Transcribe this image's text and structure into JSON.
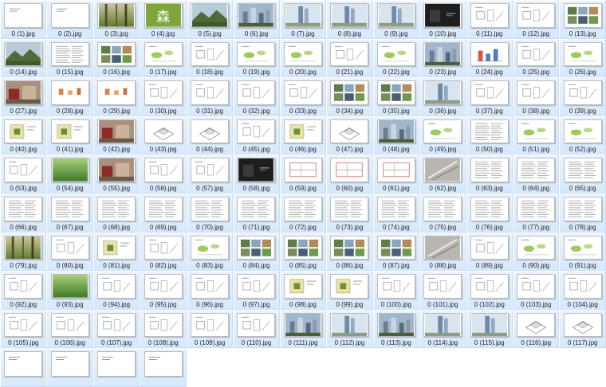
{
  "folder": {
    "colors": {
      "tile_top": "#eaf3fd",
      "tile_bottom": "#d6e8fb",
      "text": "#1f1f1f"
    },
    "thumb_icon": "image-thumbnail-icon",
    "files": [
      {
        "name": "0 (1).jpg",
        "kind": "doc-sparse"
      },
      {
        "name": "0 (2).jpg",
        "kind": "doc-sparse"
      },
      {
        "name": "0 (3).jpg",
        "kind": "photo-forest"
      },
      {
        "name": "0 (4).jpg",
        "kind": "green-glyph",
        "glyph": "森"
      },
      {
        "name": "0 (5).jpg",
        "kind": "photo-mountain"
      },
      {
        "name": "0 (6).jpg",
        "kind": "photo-city"
      },
      {
        "name": "0 (7).jpg",
        "kind": "photo-towers"
      },
      {
        "name": "0 (8).jpg",
        "kind": "photo-towers"
      },
      {
        "name": "0 (9).jpg",
        "kind": "photo-towers"
      },
      {
        "name": "0 (10).jpg",
        "kind": "dark-cover"
      },
      {
        "name": "0 (11).jpg",
        "kind": "diagram"
      },
      {
        "name": "0 (12).jpg",
        "kind": "diagram"
      },
      {
        "name": "0 (13).jpg",
        "kind": "photo-collage"
      },
      {
        "name": "0 (14).jpg",
        "kind": "photo-mountain"
      },
      {
        "name": "0 (15).jpg",
        "kind": "doc-text"
      },
      {
        "name": "0 (16).jpg",
        "kind": "photo-collage"
      },
      {
        "name": "0 (17).jpg",
        "kind": "diagram-green"
      },
      {
        "name": "0 (18).jpg",
        "kind": "diagram"
      },
      {
        "name": "0 (19).jpg",
        "kind": "diagram-green"
      },
      {
        "name": "0 (20).jpg",
        "kind": "diagram-green"
      },
      {
        "name": "0 (21).jpg",
        "kind": "diagram"
      },
      {
        "name": "0 (22).jpg",
        "kind": "diagram-green"
      },
      {
        "name": "0 (23).jpg",
        "kind": "photo-city"
      },
      {
        "name": "0 (24).jpg",
        "kind": "chart-bars"
      },
      {
        "name": "0 (25).jpg",
        "kind": "diagram"
      },
      {
        "name": "0 (26).jpg",
        "kind": "diagram-green"
      },
      {
        "name": "0 (27).jpg",
        "kind": "photo-red"
      },
      {
        "name": "0 (28).jpg",
        "kind": "diagram-orange"
      },
      {
        "name": "0 (29).jpg",
        "kind": "diagram-orange"
      },
      {
        "name": "0 (30).jpg",
        "kind": "diagram"
      },
      {
        "name": "0 (31).jpg",
        "kind": "diagram"
      },
      {
        "name": "0 (32).jpg",
        "kind": "diagram"
      },
      {
        "name": "0 (33).jpg",
        "kind": "diagram"
      },
      {
        "name": "0 (34).jpg",
        "kind": "photo-collage"
      },
      {
        "name": "0 (35).jpg",
        "kind": "photo-collage"
      },
      {
        "name": "0 (36).jpg",
        "kind": "photo-towers"
      },
      {
        "name": "0 (37).jpg",
        "kind": "diagram"
      },
      {
        "name": "0 (38).jpg",
        "kind": "diagram"
      },
      {
        "name": "0 (39).jpg",
        "kind": "diagram"
      },
      {
        "name": "0 (40).jpg",
        "kind": "plan-yellow"
      },
      {
        "name": "0 (41).jpg",
        "kind": "plan-yellow"
      },
      {
        "name": "0 (42).jpg",
        "kind": "photo-red"
      },
      {
        "name": "0 (43).jpg",
        "kind": "iso-drawing"
      },
      {
        "name": "0 (44).jpg",
        "kind": "iso-drawing"
      },
      {
        "name": "0 (45).jpg",
        "kind": "diagram"
      },
      {
        "name": "0 (46).jpg",
        "kind": "plan-yellow"
      },
      {
        "name": "0 (47).jpg",
        "kind": "iso-drawing"
      },
      {
        "name": "0 (48).jpg",
        "kind": "photo-city"
      },
      {
        "name": "0 (49).jpg",
        "kind": "diagram-green"
      },
      {
        "name": "0 (50).jpg",
        "kind": "doc-text"
      },
      {
        "name": "0 (51).jpg",
        "kind": "diagram-green"
      },
      {
        "name": "0 (52).jpg",
        "kind": "diagram-green"
      },
      {
        "name": "0 (53).jpg",
        "kind": "diagram"
      },
      {
        "name": "0 (54).jpg",
        "kind": "photo-green"
      },
      {
        "name": "0 (55).jpg",
        "kind": "photo-red"
      },
      {
        "name": "0 (56).jpg",
        "kind": "diagram"
      },
      {
        "name": "0 (57).jpg",
        "kind": "diagram"
      },
      {
        "name": "0 (58).jpg",
        "kind": "dark-cover"
      },
      {
        "name": "0 (59).jpg",
        "kind": "plan-red"
      },
      {
        "name": "0 (60).jpg",
        "kind": "plan-red"
      },
      {
        "name": "0 (61).jpg",
        "kind": "plan-red"
      },
      {
        "name": "0 (62).jpg",
        "kind": "photo-gray"
      },
      {
        "name": "0 (63).jpg",
        "kind": "doc-text"
      },
      {
        "name": "0 (64).jpg",
        "kind": "doc-text"
      },
      {
        "name": "0 (65).jpg",
        "kind": "doc-text"
      },
      {
        "name": "0 (66).jpg",
        "kind": "doc-text"
      },
      {
        "name": "0 (67).jpg",
        "kind": "doc-text"
      },
      {
        "name": "0 (68).jpg",
        "kind": "doc-text"
      },
      {
        "name": "0 (69).jpg",
        "kind": "doc-text"
      },
      {
        "name": "0 (70).jpg",
        "kind": "doc-text"
      },
      {
        "name": "0 (71).jpg",
        "kind": "doc-text"
      },
      {
        "name": "0 (72).jpg",
        "kind": "doc-text"
      },
      {
        "name": "0 (73).jpg",
        "kind": "doc-text"
      },
      {
        "name": "0 (74).jpg",
        "kind": "doc-text"
      },
      {
        "name": "0 (75).jpg",
        "kind": "doc-text"
      },
      {
        "name": "0 (76).jpg",
        "kind": "doc-text"
      },
      {
        "name": "0 (77).jpg",
        "kind": "doc-text"
      },
      {
        "name": "0 (78).jpg",
        "kind": "doc-text"
      },
      {
        "name": "0 (79).jpg",
        "kind": "photo-forest"
      },
      {
        "name": "0 (80).jpg",
        "kind": "diagram"
      },
      {
        "name": "0 (81).jpg",
        "kind": "plan-yellow"
      },
      {
        "name": "0 (82).jpg",
        "kind": "diagram"
      },
      {
        "name": "0 (83).jpg",
        "kind": "diagram-green"
      },
      {
        "name": "0 (84).jpg",
        "kind": "photo-collage"
      },
      {
        "name": "0 (85).jpg",
        "kind": "photo-collage"
      },
      {
        "name": "0 (86).jpg",
        "kind": "photo-collage"
      },
      {
        "name": "0 (87).jpg",
        "kind": "photo-collage"
      },
      {
        "name": "0 (88).jpg",
        "kind": "photo-gray"
      },
      {
        "name": "0 (89).jpg",
        "kind": "diagram"
      },
      {
        "name": "0 (90).jpg",
        "kind": "diagram-green"
      },
      {
        "name": "0 (91).jpg",
        "kind": "diagram-green"
      },
      {
        "name": "0 (92).jpg",
        "kind": "diagram"
      },
      {
        "name": "0 (93).jpg",
        "kind": "photo-green"
      },
      {
        "name": "0 (94).jpg",
        "kind": "diagram"
      },
      {
        "name": "0 (95).jpg",
        "kind": "diagram"
      },
      {
        "name": "0 (96).jpg",
        "kind": "diagram"
      },
      {
        "name": "0 (97).jpg",
        "kind": "diagram"
      },
      {
        "name": "0 (98).jpg",
        "kind": "plan-yellow"
      },
      {
        "name": "0 (99).jpg",
        "kind": "plan-yellow"
      },
      {
        "name": "0 (100).jpg",
        "kind": "diagram"
      },
      {
        "name": "0 (101).jpg",
        "kind": "diagram"
      },
      {
        "name": "0 (102).jpg",
        "kind": "diagram"
      },
      {
        "name": "0 (103).jpg",
        "kind": "diagram"
      },
      {
        "name": "0 (104).jpg",
        "kind": "diagram"
      },
      {
        "name": "0 (105).jpg",
        "kind": "diagram"
      },
      {
        "name": "0 (106).jpg",
        "kind": "diagram"
      },
      {
        "name": "0 (107).jpg",
        "kind": "diagram"
      },
      {
        "name": "0 (108).jpg",
        "kind": "diagram"
      },
      {
        "name": "0 (109).jpg",
        "kind": "diagram"
      },
      {
        "name": "0 (110).jpg",
        "kind": "diagram"
      },
      {
        "name": "0 (111).jpg",
        "kind": "photo-city"
      },
      {
        "name": "0 (112).jpg",
        "kind": "photo-towers"
      },
      {
        "name": "0 (113).jpg",
        "kind": "photo-city"
      },
      {
        "name": "0 (114).jpg",
        "kind": "photo-towers"
      },
      {
        "name": "0 (115).jpg",
        "kind": "photo-towers"
      },
      {
        "name": "0 (116).jpg",
        "kind": "iso-drawing"
      },
      {
        "name": "0 (117).jpg",
        "kind": "iso-drawing"
      },
      {
        "name": "",
        "kind": "doc-sparse",
        "partial": true
      },
      {
        "name": "",
        "kind": "doc-sparse",
        "partial": true
      },
      {
        "name": "",
        "kind": "doc-sparse",
        "partial": true
      },
      {
        "name": "",
        "kind": "doc-sparse",
        "partial": true
      }
    ]
  }
}
